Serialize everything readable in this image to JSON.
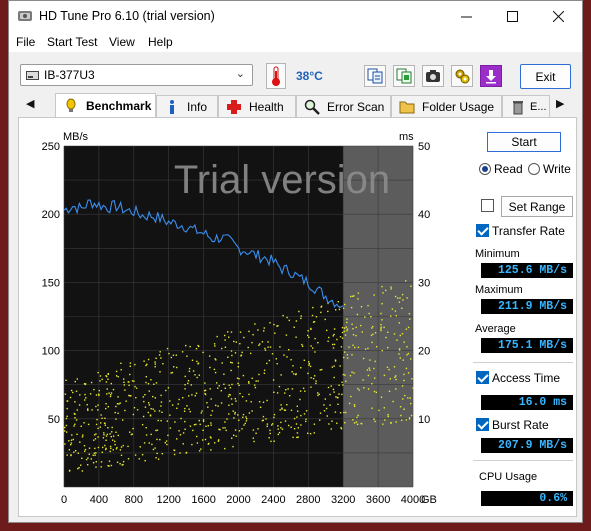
{
  "window": {
    "title": "HD Tune Pro 6.10 (trial version)",
    "minimize_icon": "minimize-icon",
    "maximize_icon": "maximize-icon",
    "close_icon": "close-icon"
  },
  "menu": [
    "File",
    "Start Test",
    "View",
    "Help"
  ],
  "toolbar": {
    "drive": "IB-377U3",
    "temperature": "38°C",
    "exit_label": "Exit",
    "tool_icons": [
      "copy-text-icon",
      "copy-screenshot-icon",
      "camera-icon",
      "settings-icon",
      "download-icon"
    ]
  },
  "tabs": [
    {
      "label": "Benchmark",
      "icon": "benchmark-icon",
      "active": true
    },
    {
      "label": "Info",
      "icon": "info-icon",
      "active": false
    },
    {
      "label": "Health",
      "icon": "health-icon",
      "active": false
    },
    {
      "label": "Error Scan",
      "icon": "error-scan-icon",
      "active": false
    },
    {
      "label": "Folder Usage",
      "icon": "folder-icon",
      "active": false
    },
    {
      "label": "E...",
      "icon": "erase-icon",
      "active": false
    }
  ],
  "side": {
    "start_label": "Start",
    "read_label": "Read",
    "write_label": "Write",
    "mode": "Read",
    "range_checked": false,
    "set_range_label": "Set Range",
    "transfer_rate_label": "Transfer Rate",
    "transfer_rate_checked": true,
    "minimum_label": "Minimum",
    "minimum_value": "125.6 MB/s",
    "maximum_label": "Maximum",
    "maximum_value": "211.9 MB/s",
    "average_label": "Average",
    "average_value": "175.1 MB/s",
    "access_time_label": "Access Time",
    "access_time_checked": true,
    "access_time_value": "16.0 ms",
    "burst_rate_label": "Burst Rate",
    "burst_rate_checked": true,
    "burst_rate_value": "207.9 MB/s",
    "cpu_usage_label": "CPU Usage",
    "cpu_usage_value": "0.6%"
  },
  "chart_data": {
    "type": "line",
    "watermark": "Trial version",
    "y_left_unit": "MB/s",
    "y_right_unit": "ms",
    "x_unit": "GB",
    "x_range": [
      0,
      4000
    ],
    "y_left_range": [
      0,
      250
    ],
    "y_right_range": [
      0,
      50
    ],
    "x_ticks": [
      "0",
      "400",
      "800",
      "1200",
      "1600",
      "2000",
      "2400",
      "2800",
      "3200",
      "3600",
      "4000"
    ],
    "y_left_ticks": [
      "50",
      "100",
      "150",
      "200",
      "250"
    ],
    "y_right_ticks": [
      "10",
      "20",
      "30",
      "40",
      "50"
    ],
    "tested_until_gb": 3200,
    "series": [
      {
        "name": "Transfer Rate",
        "color": "#3b8ef0",
        "x": [
          0,
          100,
          200,
          300,
          400,
          500,
          600,
          700,
          800,
          900,
          1000,
          1100,
          1200,
          1300,
          1400,
          1500,
          1600,
          1700,
          1800,
          1900,
          2000,
          2100,
          2200,
          2300,
          2400,
          2500,
          2600,
          2700,
          2800,
          2900,
          3000,
          3100,
          3200
        ],
        "y": [
          203,
          206,
          204,
          209,
          207,
          205,
          206,
          203,
          202,
          199,
          199,
          197,
          194,
          193,
          191,
          188,
          186,
          182,
          183,
          180,
          175,
          173,
          170,
          168,
          165,
          160,
          158,
          153,
          150,
          145,
          140,
          136,
          133
        ]
      },
      {
        "name": "Access Time",
        "color": "#e8e830",
        "type": "scatter",
        "x_range": [
          0,
          4000
        ],
        "y_range_ms": [
          2,
          31
        ],
        "mean_ms": 16.0
      }
    ]
  }
}
